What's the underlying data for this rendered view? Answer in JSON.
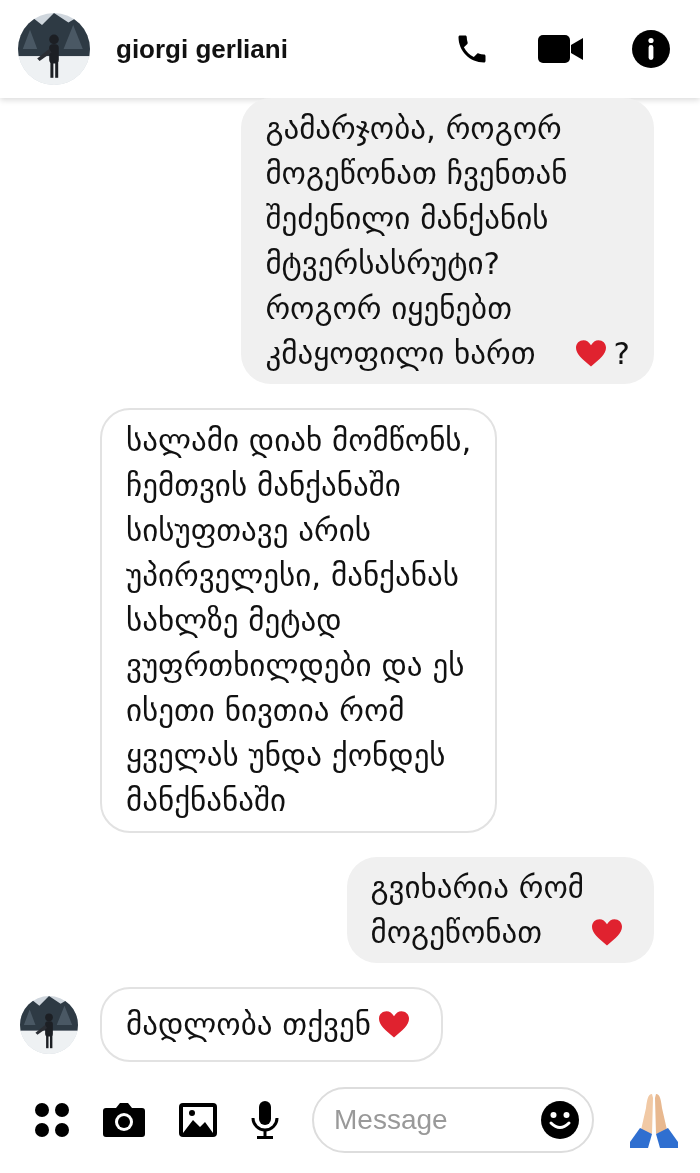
{
  "header": {
    "name": "giorgi gerliani"
  },
  "messages": [
    {
      "kind": "outgoing",
      "avatar": false,
      "parts": [
        {
          "kind": "text",
          "text": "გამარჯობა, როგორ\nმოგეწონათ ჩვენთან\nშეძენილი მანქანის\nმტვერსასრუტი?\nროგორ იყენებთ\nკმაყოფილი ხართ"
        },
        {
          "kind": "heart"
        },
        {
          "kind": "text",
          "text": "?"
        }
      ]
    },
    {
      "kind": "incoming",
      "avatar": false,
      "parts": [
        {
          "kind": "text",
          "text": "სალამი დიახ მომწონს,\nჩემთვის მანქანაში\nსისუფთავე არის\nუპირველესი, მანქანას\nსახლზე მეტად\nვუფრთხილდები და ეს\nისეთი ნივთია რომ\nყველას უნდა ქონდეს\nმანქნანაში"
        }
      ]
    },
    {
      "kind": "outgoing",
      "avatar": false,
      "parts": [
        {
          "kind": "text",
          "text": "გვიხარია რომ\nმოგეწონათ"
        },
        {
          "kind": "heart"
        }
      ]
    },
    {
      "kind": "incoming",
      "avatar": true,
      "parts": [
        {
          "kind": "text",
          "text": "მადლობა თქვენ"
        },
        {
          "kind": "heart"
        }
      ]
    }
  ],
  "composer": {
    "placeholder": "Message"
  }
}
